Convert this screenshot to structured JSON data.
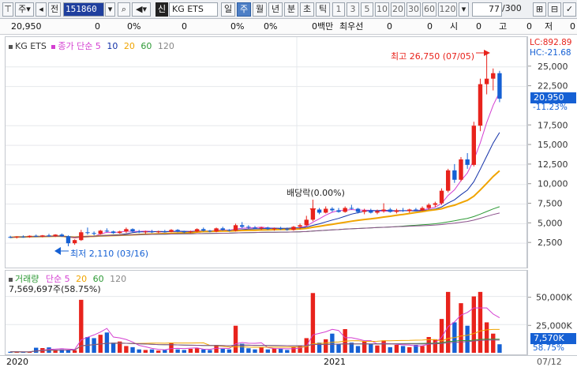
{
  "toolbar": {
    "market": "주",
    "period_label": "전",
    "code": "151860",
    "badge": "신",
    "name": "KG ETS",
    "periods": [
      "일",
      "주",
      "월",
      "년",
      "분",
      "초",
      "틱"
    ],
    "active_period": "주",
    "intervals": [
      "1",
      "3",
      "5",
      "10",
      "20",
      "30",
      "60",
      "120"
    ],
    "count": "77",
    "total": "/300"
  },
  "infobar": {
    "price": "20,950",
    "v1": "0",
    "p1": "0%",
    "v2": "0",
    "p2": "0%",
    "p3": "0%",
    "v3": "0백만",
    "label_best": "최우선",
    "v4": "0",
    "v5": "0",
    "label_open": "시",
    "v6": "0",
    "label_high": "고",
    "v7": "0",
    "label_low": "저",
    "v8": "0"
  },
  "price_legend": {
    "name": "KG ETS",
    "ma_label": "종가 단순 5",
    "ma10": "10",
    "ma20": "20",
    "ma60": "60",
    "ma120": "120"
  },
  "volume_legend": {
    "name": "거래량",
    "ma_label": "단순 5",
    "ma20": "20",
    "ma60": "60",
    "ma120": "120",
    "value": "7,569,697주(58.75%)"
  },
  "annotations": {
    "high": "최고 26,750 (07/05)",
    "low": "최저 2,110 (03/16)",
    "dividend": "배당락(0.00%)",
    "lc": "LC:892.89",
    "hc": "HC:-21.68",
    "current_price": "20,950",
    "current_change": "-11.23%",
    "current_volume": "7,570K",
    "current_volume_pct": "58.75%"
  },
  "price_axis": {
    "ticks": [
      {
        "label": "25,000",
        "value": 25000
      },
      {
        "label": "22,500",
        "value": 22500
      },
      {
        "label": "17,500",
        "value": 17500
      },
      {
        "label": "15,000",
        "value": 15000
      },
      {
        "label": "12,500",
        "value": 12500
      },
      {
        "label": "10,000",
        "value": 10000
      },
      {
        "label": "7,500",
        "value": 7500
      },
      {
        "label": "5,000",
        "value": 5000
      },
      {
        "label": "2,500",
        "value": 2500
      }
    ]
  },
  "volume_axis": {
    "ticks": [
      {
        "label": "50,000K",
        "value": 50000
      },
      {
        "label": "25,000K",
        "value": 25000
      }
    ]
  },
  "date_axis": {
    "labels": [
      "2020",
      "2021",
      "07/12"
    ]
  },
  "colors": {
    "up": "#e8231c",
    "down": "#1560d4",
    "ma5": "#d43fd1",
    "ma10": "#1230a8",
    "ma20": "#f0a400",
    "ma60": "#2e9a36",
    "ma120": "#8a4f8a"
  },
  "chart_data": {
    "type": "candlestick",
    "title": "KG ETS",
    "ylim": [
      0,
      28000
    ],
    "volume_ylim": [
      0,
      70000
    ],
    "candles": [
      {
        "o": 3300,
        "h": 3450,
        "l": 3150,
        "c": 3250,
        "v": 900
      },
      {
        "o": 3250,
        "h": 3400,
        "l": 3100,
        "c": 3350,
        "v": 800
      },
      {
        "o": 3350,
        "h": 3500,
        "l": 3200,
        "c": 3300,
        "v": 700
      },
      {
        "o": 3300,
        "h": 3500,
        "l": 3200,
        "c": 3450,
        "v": 900
      },
      {
        "o": 3450,
        "h": 3600,
        "l": 3300,
        "c": 3350,
        "v": 4500
      },
      {
        "o": 3350,
        "h": 3550,
        "l": 3250,
        "c": 3500,
        "v": 4200
      },
      {
        "o": 3500,
        "h": 3700,
        "l": 3300,
        "c": 3400,
        "v": 4800
      },
      {
        "o": 3400,
        "h": 3650,
        "l": 3300,
        "c": 3600,
        "v": 2000
      },
      {
        "o": 3600,
        "h": 3750,
        "l": 3300,
        "c": 3400,
        "v": 3000
      },
      {
        "o": 3400,
        "h": 3500,
        "l": 2110,
        "c": 2500,
        "v": 2800
      },
      {
        "o": 2500,
        "h": 3000,
        "l": 2300,
        "c": 2900,
        "v": 2200
      },
      {
        "o": 2900,
        "h": 4200,
        "l": 2800,
        "c": 3900,
        "v": 47000
      },
      {
        "o": 3900,
        "h": 4500,
        "l": 3600,
        "c": 3800,
        "v": 14000
      },
      {
        "o": 3800,
        "h": 4000,
        "l": 3500,
        "c": 3700,
        "v": 13000
      },
      {
        "o": 3700,
        "h": 4200,
        "l": 3600,
        "c": 4100,
        "v": 16000
      },
      {
        "o": 4100,
        "h": 4400,
        "l": 3900,
        "c": 4000,
        "v": 18000
      },
      {
        "o": 4000,
        "h": 4100,
        "l": 3700,
        "c": 3800,
        "v": 9000
      },
      {
        "o": 3800,
        "h": 4100,
        "l": 3700,
        "c": 4000,
        "v": 10000
      },
      {
        "o": 4000,
        "h": 4500,
        "l": 3800,
        "c": 4300,
        "v": 6000
      },
      {
        "o": 4300,
        "h": 4400,
        "l": 3900,
        "c": 4000,
        "v": 5000
      },
      {
        "o": 4000,
        "h": 4200,
        "l": 3800,
        "c": 3900,
        "v": 3000
      },
      {
        "o": 3900,
        "h": 4100,
        "l": 3700,
        "c": 4000,
        "v": 2500
      },
      {
        "o": 4000,
        "h": 4200,
        "l": 3800,
        "c": 3900,
        "v": 3000
      },
      {
        "o": 3900,
        "h": 4100,
        "l": 3800,
        "c": 4000,
        "v": 2000
      },
      {
        "o": 4000,
        "h": 4200,
        "l": 3850,
        "c": 3950,
        "v": 2500
      },
      {
        "o": 3950,
        "h": 4300,
        "l": 3900,
        "c": 4200,
        "v": 9000
      },
      {
        "o": 4200,
        "h": 4300,
        "l": 3900,
        "c": 4000,
        "v": 3000
      },
      {
        "o": 4000,
        "h": 4100,
        "l": 3800,
        "c": 3900,
        "v": 2500
      },
      {
        "o": 3900,
        "h": 4100,
        "l": 3800,
        "c": 4000,
        "v": 3500
      },
      {
        "o": 4000,
        "h": 4400,
        "l": 3900,
        "c": 4300,
        "v": 4000
      },
      {
        "o": 4300,
        "h": 4500,
        "l": 4000,
        "c": 4100,
        "v": 3000
      },
      {
        "o": 4100,
        "h": 4200,
        "l": 3900,
        "c": 4000,
        "v": 2500
      },
      {
        "o": 4000,
        "h": 4500,
        "l": 3900,
        "c": 4400,
        "v": 7000
      },
      {
        "o": 4400,
        "h": 4600,
        "l": 4100,
        "c": 4200,
        "v": 3500
      },
      {
        "o": 4200,
        "h": 4300,
        "l": 4000,
        "c": 4100,
        "v": 3000
      },
      {
        "o": 4100,
        "h": 5000,
        "l": 4000,
        "c": 4800,
        "v": 24000
      },
      {
        "o": 4800,
        "h": 5200,
        "l": 4400,
        "c": 4600,
        "v": 8000
      },
      {
        "o": 4600,
        "h": 4800,
        "l": 4300,
        "c": 4500,
        "v": 4000
      },
      {
        "o": 4500,
        "h": 4700,
        "l": 4300,
        "c": 4400,
        "v": 3000
      },
      {
        "o": 4400,
        "h": 4600,
        "l": 4200,
        "c": 4500,
        "v": 5000
      },
      {
        "o": 4500,
        "h": 4600,
        "l": 4200,
        "c": 4300,
        "v": 3000
      },
      {
        "o": 4300,
        "h": 4500,
        "l": 4100,
        "c": 4400,
        "v": 4000
      },
      {
        "o": 4400,
        "h": 4600,
        "l": 4200,
        "c": 4300,
        "v": 3500
      },
      {
        "o": 4300,
        "h": 4500,
        "l": 4100,
        "c": 4200,
        "v": 2500
      },
      {
        "o": 4200,
        "h": 4700,
        "l": 4100,
        "c": 4600,
        "v": 5000
      },
      {
        "o": 4600,
        "h": 5000,
        "l": 4300,
        "c": 4800,
        "v": 6000
      },
      {
        "o": 4800,
        "h": 6000,
        "l": 4700,
        "c": 5500,
        "v": 13000
      },
      {
        "o": 5500,
        "h": 7200,
        "l": 5300,
        "c": 6800,
        "v": 53000
      },
      {
        "o": 6800,
        "h": 7000,
        "l": 6200,
        "c": 6400,
        "v": 9000
      },
      {
        "o": 6400,
        "h": 7200,
        "l": 6300,
        "c": 6900,
        "v": 12000
      },
      {
        "o": 6900,
        "h": 7100,
        "l": 6500,
        "c": 6700,
        "v": 17000
      },
      {
        "o": 6700,
        "h": 7000,
        "l": 6400,
        "c": 6500,
        "v": 8000
      },
      {
        "o": 6500,
        "h": 7200,
        "l": 6400,
        "c": 7000,
        "v": 21000
      },
      {
        "o": 7000,
        "h": 7400,
        "l": 6800,
        "c": 6900,
        "v": 9000
      },
      {
        "o": 6900,
        "h": 7000,
        "l": 6300,
        "c": 6500,
        "v": 6000
      },
      {
        "o": 6500,
        "h": 6900,
        "l": 6200,
        "c": 6700,
        "v": 10000
      },
      {
        "o": 6700,
        "h": 6900,
        "l": 6300,
        "c": 6400,
        "v": 8000
      },
      {
        "o": 6400,
        "h": 6800,
        "l": 6200,
        "c": 6600,
        "v": 6500
      },
      {
        "o": 6600,
        "h": 7600,
        "l": 6400,
        "c": 6800,
        "v": 11000
      },
      {
        "o": 6800,
        "h": 7000,
        "l": 6400,
        "c": 6500,
        "v": 5000
      },
      {
        "o": 6500,
        "h": 6900,
        "l": 6300,
        "c": 6700,
        "v": 7000
      },
      {
        "o": 6700,
        "h": 7000,
        "l": 6500,
        "c": 6600,
        "v": 6000
      },
      {
        "o": 6600,
        "h": 6900,
        "l": 6400,
        "c": 6800,
        "v": 5000
      },
      {
        "o": 6800,
        "h": 7000,
        "l": 6600,
        "c": 6700,
        "v": 7000
      },
      {
        "o": 6700,
        "h": 7200,
        "l": 6600,
        "c": 7000,
        "v": 6000
      },
      {
        "o": 7000,
        "h": 7600,
        "l": 6800,
        "c": 7400,
        "v": 14000
      },
      {
        "o": 7400,
        "h": 7800,
        "l": 7100,
        "c": 7600,
        "v": 12000
      },
      {
        "o": 7600,
        "h": 9500,
        "l": 7400,
        "c": 9200,
        "v": 30000
      },
      {
        "o": 9200,
        "h": 12000,
        "l": 9000,
        "c": 11800,
        "v": 54000
      },
      {
        "o": 11800,
        "h": 12600,
        "l": 10200,
        "c": 10600,
        "v": 27000
      },
      {
        "o": 10600,
        "h": 13500,
        "l": 10400,
        "c": 13200,
        "v": 44000
      },
      {
        "o": 13200,
        "h": 14000,
        "l": 12000,
        "c": 12500,
        "v": 24000
      },
      {
        "o": 12500,
        "h": 18000,
        "l": 12300,
        "c": 17500,
        "v": 50000
      },
      {
        "o": 17500,
        "h": 23500,
        "l": 16800,
        "c": 22800,
        "v": 54000
      },
      {
        "o": 22800,
        "h": 26750,
        "l": 21500,
        "c": 23500,
        "v": 27000
      },
      {
        "o": 23500,
        "h": 24800,
        "l": 22000,
        "c": 24200,
        "v": 17000
      },
      {
        "o": 24200,
        "h": 24500,
        "l": 20500,
        "c": 20950,
        "v": 7570
      }
    ]
  }
}
